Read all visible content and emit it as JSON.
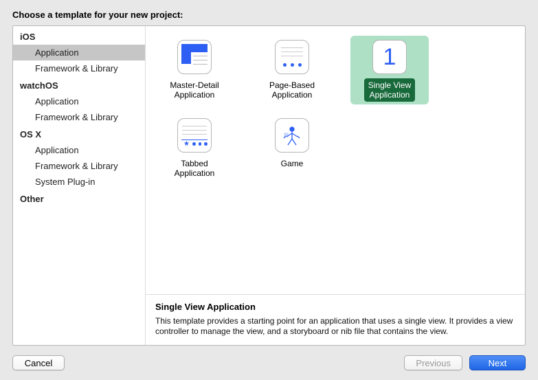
{
  "heading": "Choose a template for your new project:",
  "sidebar": {
    "groups": [
      {
        "header": "iOS",
        "items": [
          {
            "label": "Application",
            "selected": true
          },
          {
            "label": "Framework & Library",
            "selected": false
          }
        ]
      },
      {
        "header": "watchOS",
        "items": [
          {
            "label": "Application",
            "selected": false
          },
          {
            "label": "Framework & Library",
            "selected": false
          }
        ]
      },
      {
        "header": "OS X",
        "items": [
          {
            "label": "Application",
            "selected": false
          },
          {
            "label": "Framework & Library",
            "selected": false
          },
          {
            "label": "System Plug-in",
            "selected": false
          }
        ]
      },
      {
        "header": "Other",
        "items": []
      }
    ]
  },
  "templates": [
    {
      "id": "master-detail",
      "label": "Master-Detail\nApplication",
      "selected": false
    },
    {
      "id": "page-based",
      "label": "Page-Based\nApplication",
      "selected": false
    },
    {
      "id": "single-view",
      "label": "Single View\nApplication",
      "selected": true
    },
    {
      "id": "tabbed",
      "label": "Tabbed\nApplication",
      "selected": false
    },
    {
      "id": "game",
      "label": "Game",
      "selected": false
    }
  ],
  "description": {
    "title": "Single View Application",
    "body": "This template provides a starting point for an application that uses a single view. It provides a view controller to manage the view, and a storyboard or nib file that contains the view."
  },
  "buttons": {
    "cancel": "Cancel",
    "previous": "Previous",
    "next": "Next"
  }
}
